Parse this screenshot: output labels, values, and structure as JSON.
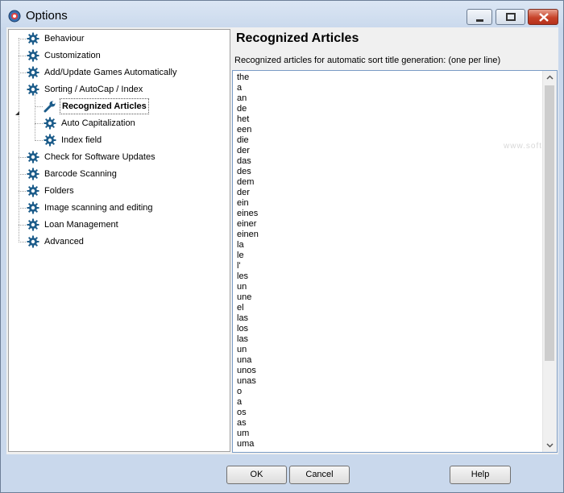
{
  "window": {
    "title": "Options"
  },
  "tree": {
    "items": [
      {
        "label": "Behaviour",
        "level": 0,
        "icon": "gear-icon"
      },
      {
        "label": "Customization",
        "level": 0,
        "icon": "gear-icon"
      },
      {
        "label": "Add/Update Games Automatically",
        "level": 0,
        "icon": "gear-icon"
      },
      {
        "label": "Sorting / AutoCap / Index",
        "level": 0,
        "icon": "gear-icon",
        "expanded": true
      },
      {
        "label": "Recognized Articles",
        "level": 1,
        "icon": "wrench-icon",
        "selected": true
      },
      {
        "label": "Auto Capitalization",
        "level": 1,
        "icon": "gear-icon"
      },
      {
        "label": "Index field",
        "level": 1,
        "icon": "gear-icon"
      },
      {
        "label": "Check for Software Updates",
        "level": 0,
        "icon": "gear-icon"
      },
      {
        "label": "Barcode Scanning",
        "level": 0,
        "icon": "gear-icon"
      },
      {
        "label": "Folders",
        "level": 0,
        "icon": "gear-icon"
      },
      {
        "label": "Image scanning and editing",
        "level": 0,
        "icon": "gear-icon"
      },
      {
        "label": "Loan Management",
        "level": 0,
        "icon": "gear-icon"
      },
      {
        "label": "Advanced",
        "level": 0,
        "icon": "gear-icon"
      }
    ]
  },
  "panel": {
    "title": "Recognized Articles",
    "subtitle": "Recognized articles for automatic sort title generation: (one per line)",
    "articles": [
      "the",
      "a",
      "an",
      "de",
      "het",
      "een",
      "die",
      "der",
      "das",
      "des",
      "dem",
      "der",
      "ein",
      "eines",
      "einer",
      "einen",
      "la",
      "le",
      "l'",
      "les",
      "un",
      "une",
      "el",
      "las",
      "los",
      "las",
      "un",
      "una",
      "unos",
      "unas",
      "o",
      "a",
      "os",
      "as",
      "um",
      "uma"
    ],
    "watermark": "www.softpedia.com"
  },
  "buttons": {
    "ok": "OK",
    "cancel": "Cancel",
    "help": "Help"
  },
  "colors": {
    "accent": "#1c5c8a",
    "selection_border": "#555555",
    "close_button": "#c7432a"
  }
}
